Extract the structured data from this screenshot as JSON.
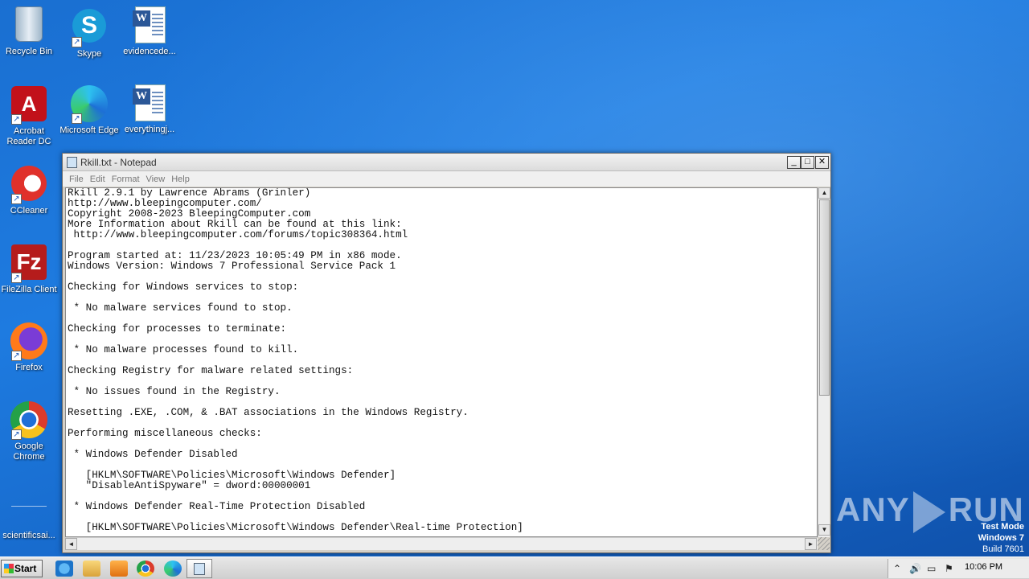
{
  "desktop": {
    "icons": [
      {
        "label": "Recycle Bin",
        "icon": "recycle-bin-icon"
      },
      {
        "label": "Skype",
        "icon": "skype-icon"
      },
      {
        "label": "evidencede...",
        "icon": "word-document-icon"
      },
      {
        "label": "Acrobat Reader DC",
        "icon": "acrobat-icon"
      },
      {
        "label": "Microsoft Edge",
        "icon": "edge-icon"
      },
      {
        "label": "everythingj...",
        "icon": "word-document-icon"
      },
      {
        "label": "CCleaner",
        "icon": "ccleaner-icon"
      },
      {
        "label": "FileZilla Client",
        "icon": "filezilla-icon"
      },
      {
        "label": "Firefox",
        "icon": "firefox-icon"
      },
      {
        "label": "Google Chrome",
        "icon": "chrome-icon"
      },
      {
        "label": "scientificsai...",
        "icon": "file-icon"
      }
    ],
    "watermark": "ANY RUN",
    "watermark_left": "ANY",
    "watermark_right": "RUN",
    "test_mode": {
      "line1": "Test Mode",
      "line2": "Windows 7",
      "line3": "Build 7601"
    }
  },
  "notepad": {
    "title": "Rkill.txt - Notepad",
    "controls": {
      "minimize": "_",
      "maximize": "□",
      "close": "✕"
    },
    "menu": [
      "File",
      "Edit",
      "Format",
      "View",
      "Help"
    ],
    "content": "Rkill 2.9.1 by Lawrence Abrams (Grinler)\nhttp://www.bleepingcomputer.com/\nCopyright 2008-2023 BleepingComputer.com\nMore Information about Rkill can be found at this link:\n http://www.bleepingcomputer.com/forums/topic308364.html\n\nProgram started at: 11/23/2023 10:05:49 PM in x86 mode.\nWindows Version: Windows 7 Professional Service Pack 1\n\nChecking for Windows services to stop:\n\n * No malware services found to stop.\n\nChecking for processes to terminate:\n\n * No malware processes found to kill.\n\nChecking Registry for malware related settings:\n\n * No issues found in the Registry.\n\nResetting .EXE, .COM, & .BAT associations in the Windows Registry.\n\nPerforming miscellaneous checks:\n\n * Windows Defender Disabled\n\n   [HKLM\\SOFTWARE\\Policies\\Microsoft\\Windows Defender]\n   \"DisableAntiSpyware\" = dword:00000001\n\n * Windows Defender Real-Time Protection Disabled\n\n   [HKLM\\SOFTWARE\\Policies\\Microsoft\\Windows Defender\\Real-time Protection]",
    "scroll": {
      "up": "▲",
      "down": "▼",
      "left": "◄",
      "right": "►"
    }
  },
  "taskbar": {
    "start_label": "Start",
    "pinned": [
      "internet-explorer-icon",
      "explorer-icon",
      "media-player-icon",
      "chrome-icon",
      "edge-icon",
      "notepad-icon"
    ],
    "tray": {
      "show_hidden": "⌃",
      "volume": "🔊",
      "network": "▭",
      "flag": "⚑"
    },
    "clock": "10:06 PM"
  }
}
